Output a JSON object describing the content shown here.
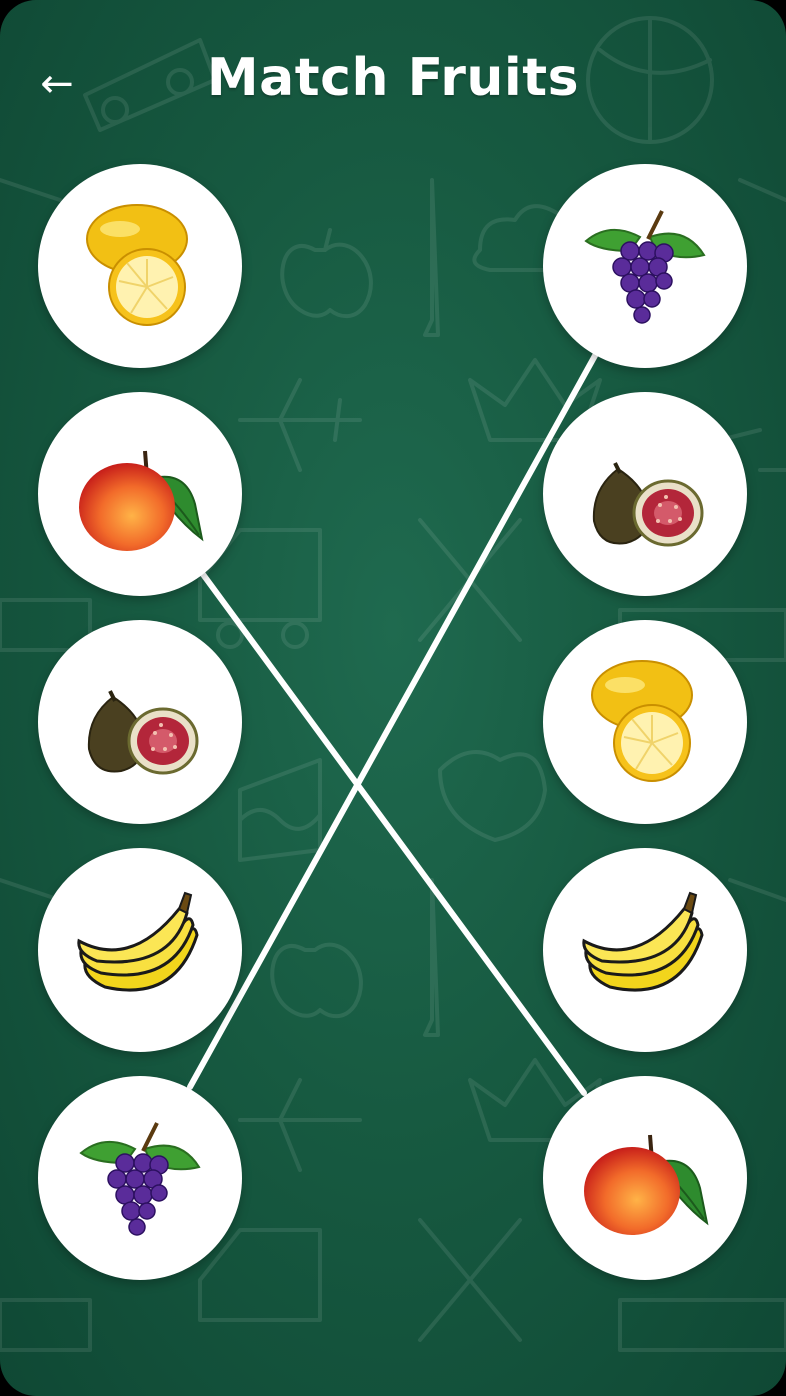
{
  "header": {
    "back_icon": "←",
    "title": "Match Fruits"
  },
  "left_column": [
    {
      "fruit": "lemon"
    },
    {
      "fruit": "peach"
    },
    {
      "fruit": "fig"
    },
    {
      "fruit": "banana"
    },
    {
      "fruit": "grapes"
    }
  ],
  "right_column": [
    {
      "fruit": "grapes"
    },
    {
      "fruit": "fig"
    },
    {
      "fruit": "lemon"
    },
    {
      "fruit": "banana"
    },
    {
      "fruit": "peach"
    }
  ],
  "connections": [
    {
      "from": "left-peach",
      "to": "right-peach"
    },
    {
      "from": "left-grapes",
      "to": "right-grapes"
    }
  ],
  "colors": {
    "background": "#175a41",
    "line": "#ffffff",
    "card": "#ffffff"
  }
}
